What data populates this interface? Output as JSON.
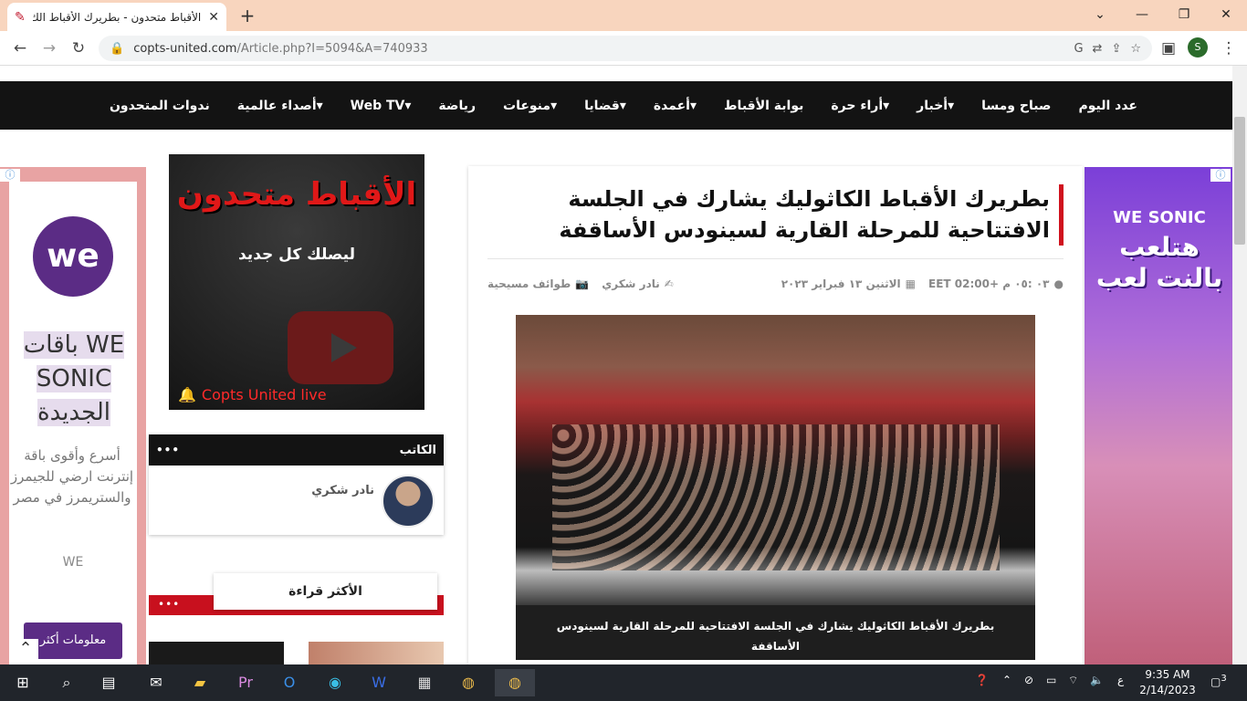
{
  "browser": {
    "tab_title": "الأقباط متحدون - بطريرك الأقباط الك",
    "url_host": "copts-united.com",
    "url_path": "/Article.php?I=5094&A=740933",
    "profile_initial": "S"
  },
  "nav": [
    "عدد اليوم",
    "صباح ومسا",
    "أخبار▾",
    "أراء حرة▾",
    "بوابة الأقباط",
    "أعمدة▾",
    "قضايا▾",
    "منوعات▾",
    "رياضة",
    "Web TV▾",
    "أصداء عالمية▾",
    "ندوات المتحدون"
  ],
  "ad_left": {
    "logo": "we",
    "headline_lines": [
      "باقات WE",
      "SONIC",
      "الجديدة"
    ],
    "body": "أسرع وأقوى باقة إنترنت ارضي للجيمرز والستريمرز في مصر",
    "brand": "WE",
    "cta": "معلومات أكثر"
  },
  "ad_right": {
    "line1": "WE SONIC",
    "line2": "هتلعب بالنت لعب"
  },
  "video": {
    "title": "الأقباط متحدون",
    "subtitle": "ليصلك كل جديد",
    "live": "Copts United live"
  },
  "author": {
    "header": "الكاتب",
    "dots": "•••",
    "name": "نادر شكري"
  },
  "most_read": {
    "title": "الأكثر قراءة",
    "dots": "•••"
  },
  "article": {
    "title": "بطريرك الأقباط الكاثوليك يشارك في الجلسة الافتتاحية للمرحلة القارية لسينودس الأساقفة",
    "category": "طوائف مسيحية",
    "author": "نادر شكري",
    "date": "الاثنين ١٣ فبراير ٢٠٢٣",
    "time": "٠٣ :٠٥ م +02:00 EET",
    "caption": "بطريرك الأقباط الكاثوليك يشارك في الجلسة الافتتاحية للمرحلة القارية لسينودس الأساقفة"
  },
  "taskbar": {
    "time": "9:35 AM",
    "date": "2/14/2023",
    "lang": "ع",
    "notif": "3"
  }
}
